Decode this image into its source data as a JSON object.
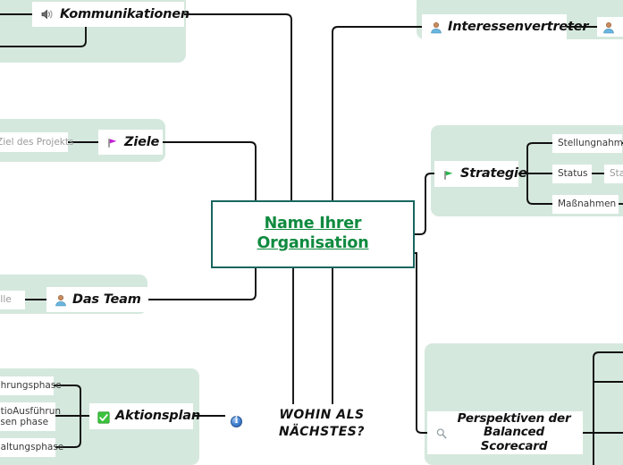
{
  "document": {
    "type": "mind-map",
    "central_node": {
      "title_line1": "Name Ihrer",
      "title_line2": "Organisation",
      "text_color": "#0f8a3f",
      "border_color": "#18665e"
    },
    "prompt": {
      "line1": "WOHIN ALS",
      "line2": "NÄCHSTES?"
    },
    "panel_color": "#d5e8dd",
    "branches": [
      {
        "id": "kommunikationen",
        "label": "Kommunikationen",
        "icon": "speaker-icon"
      },
      {
        "id": "interessenvertreter",
        "label": "Interessenvertreter",
        "icon": "person-icon",
        "children": [
          {
            "label": "",
            "icon": "person-icon"
          }
        ]
      },
      {
        "id": "ziele",
        "label": "Ziele",
        "icon": "flag-purple-icon",
        "children": [
          {
            "label": "Ziel des Projekts"
          }
        ]
      },
      {
        "id": "strategie",
        "label": "Strategie",
        "icon": "flag-green-icon",
        "children": [
          {
            "label": "Stellungnahme"
          },
          {
            "label": "Status"
          },
          {
            "label": "Maßnahmen"
          }
        ],
        "grandchildren": [
          {
            "label": "Sta"
          }
        ]
      },
      {
        "id": "das-team",
        "label": "Das Team",
        "icon": "person-icon",
        "children": [
          {
            "label": "olle"
          }
        ]
      },
      {
        "id": "aktionsplan",
        "label": "Aktionsplan",
        "icon": "checkbox-green-icon",
        "children": [
          {
            "label": "ührungsphase"
          },
          {
            "label": "utioAusführun",
            "label2": "asen phase"
          },
          {
            "label": "naltungsphase"
          }
        ],
        "note_icon": "info-icon"
      },
      {
        "id": "balanced-scorecard",
        "label_line1": "Perspektiven der",
        "label_line2": "Balanced Scorecard",
        "icon": "magnifier-icon"
      }
    ]
  }
}
